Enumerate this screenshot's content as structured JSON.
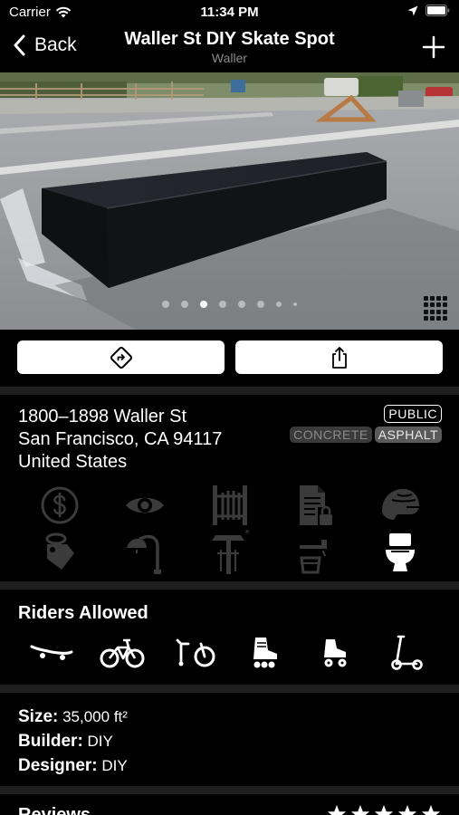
{
  "status_bar": {
    "carrier": "Carrier",
    "time": "11:34 PM"
  },
  "nav": {
    "back_label": "Back",
    "title": "Waller St DIY Skate Spot",
    "subtitle": "Waller"
  },
  "photo": {
    "page_count": 8,
    "active_index": 2
  },
  "address": {
    "line1": "1800–1898 Waller St",
    "line2": "San Francisco, CA 94117",
    "line3": "United States"
  },
  "badges": {
    "access": "PUBLIC",
    "materials": [
      "CONCRETE",
      "ASPHALT"
    ]
  },
  "amenities": [
    {
      "icon": "dollar-icon",
      "active": false
    },
    {
      "icon": "eye-icon",
      "active": false
    },
    {
      "icon": "gate-icon",
      "active": false
    },
    {
      "icon": "locked-document-icon",
      "active": false
    },
    {
      "icon": "helmet-icon",
      "active": false
    },
    {
      "icon": "tag-icon",
      "active": false
    },
    {
      "icon": "street-light-icon",
      "active": false
    },
    {
      "icon": "covered-shelter-icon",
      "active": false
    },
    {
      "icon": "water-fountain-icon",
      "active": false
    },
    {
      "icon": "toilet-icon",
      "active": true
    }
  ],
  "riders": {
    "title": "Riders Allowed",
    "icons": [
      "skateboard-icon",
      "bmx-bike-icon",
      "mountain-bike-icon",
      "inline-skate-icon",
      "roller-skate-icon",
      "scooter-icon"
    ]
  },
  "details": {
    "size_label": "Size:",
    "size_value": "35,000 ft²",
    "builder_label": "Builder:",
    "builder_value": "DIY",
    "designer_label": "Designer:",
    "designer_value": "DIY"
  },
  "reviews": {
    "title": "Reviews",
    "rating": 5
  },
  "colors": {
    "background": "#000000",
    "inactive_icon": "#3b3b3b",
    "divider": "#1e1e1e"
  }
}
